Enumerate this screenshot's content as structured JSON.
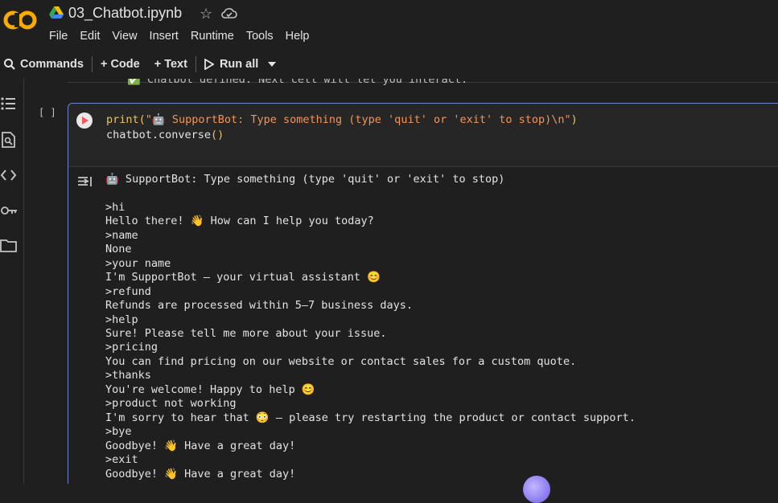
{
  "header": {
    "title": "03_Chatbot.ipynb",
    "logo_text": "CO",
    "menu": [
      "File",
      "Edit",
      "View",
      "Insert",
      "Runtime",
      "Tools",
      "Help"
    ]
  },
  "toolbar": {
    "commands_label": "Commands",
    "code_label": "+ Code",
    "text_label": "+ Text",
    "run_all_label": "Run all"
  },
  "sidebar": {
    "icons": [
      "table-of-contents-icon",
      "find-replace-icon",
      "code-snippets-icon",
      "secrets-key-icon",
      "files-folder-icon"
    ]
  },
  "previous_output": "✅ Chatbot defined. Next cell will let you interact.",
  "cell": {
    "execution_count": "[ ]",
    "code": {
      "line1_fn": "print(",
      "line1_str": "\"🤖 SupportBot: Type something (type 'quit' or 'exit' to stop)\\n\"",
      "line1_close": ")",
      "line2_obj": "chatbot.converse",
      "line2_parens": "()"
    },
    "output_lines": [
      "🤖 SupportBot: Type something (type 'quit' or 'exit' to stop)",
      "",
      ">hi",
      "Hello there! 👋 How can I help you today?",
      ">name",
      "None",
      ">your name",
      "I'm SupportBot — your virtual assistant 😊",
      ">refund",
      "Refunds are processed within 5–7 business days.",
      ">help",
      "Sure! Please tell me more about your issue.",
      ">pricing",
      "You can find pricing on our website or contact sales for a custom quote.",
      ">thanks",
      "You're welcome! Happy to help 😊",
      ">product not working",
      "I'm sorry to hear that 😳 — please try restarting the product or contact support.",
      ">bye",
      "Goodbye! 👋 Have a great day!",
      ">exit",
      "Goodbye! 👋 Have a great day!"
    ]
  },
  "colors": {
    "accent_border": "#6d84c9",
    "logo_orange": "#f9ab00",
    "run_button_red": "#f25a5a"
  }
}
